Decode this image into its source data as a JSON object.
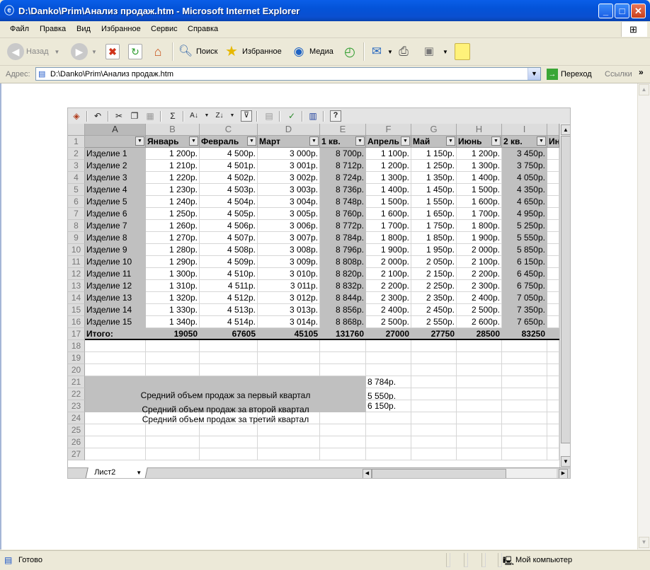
{
  "window": {
    "title": "D:\\Danko\\Prim\\Анализ продаж.htm - Microsoft Internet Explorer"
  },
  "menu": [
    "Файл",
    "Правка",
    "Вид",
    "Избранное",
    "Сервис",
    "Справка"
  ],
  "toolbar": {
    "back": "Назад",
    "search": "Поиск",
    "favorites": "Избранное",
    "media": "Медиа"
  },
  "address": {
    "label": "Адрес:",
    "url": "D:\\Danko\\Prim\\Анализ продаж.htm",
    "go": "Переход",
    "links": "Ссылки"
  },
  "status": {
    "text": "Готово",
    "zone": "Мой компьютер"
  },
  "spreadsheet": {
    "columns": [
      "A",
      "B",
      "C",
      "D",
      "E",
      "F",
      "G",
      "H",
      "I"
    ],
    "headers": [
      "",
      "Январь",
      "Февраль",
      "Март",
      "1 кв.",
      "Апрель",
      "Май",
      "Июнь",
      "2 кв.",
      "Ин"
    ],
    "rows": [
      [
        "Изделие 1",
        "1 200р.",
        "4 500р.",
        "3 000р.",
        "8 700р.",
        "1 100р.",
        "1 150р.",
        "1 200р.",
        "3 450р."
      ],
      [
        "Изделие 2",
        "1 210р.",
        "4 501р.",
        "3 001р.",
        "8 712р.",
        "1 200р.",
        "1 250р.",
        "1 300р.",
        "3 750р."
      ],
      [
        "Изделие 3",
        "1 220р.",
        "4 502р.",
        "3 002р.",
        "8 724р.",
        "1 300р.",
        "1 350р.",
        "1 400р.",
        "4 050р."
      ],
      [
        "Изделие 4",
        "1 230р.",
        "4 503р.",
        "3 003р.",
        "8 736р.",
        "1 400р.",
        "1 450р.",
        "1 500р.",
        "4 350р."
      ],
      [
        "Изделие 5",
        "1 240р.",
        "4 504р.",
        "3 004р.",
        "8 748р.",
        "1 500р.",
        "1 550р.",
        "1 600р.",
        "4 650р."
      ],
      [
        "Изделие 6",
        "1 250р.",
        "4 505р.",
        "3 005р.",
        "8 760р.",
        "1 600р.",
        "1 650р.",
        "1 700р.",
        "4 950р."
      ],
      [
        "Изделие 7",
        "1 260р.",
        "4 506р.",
        "3 006р.",
        "8 772р.",
        "1 700р.",
        "1 750р.",
        "1 800р.",
        "5 250р."
      ],
      [
        "Изделие 8",
        "1 270р.",
        "4 507р.",
        "3 007р.",
        "8 784р.",
        "1 800р.",
        "1 850р.",
        "1 900р.",
        "5 550р."
      ],
      [
        "Изделие 9",
        "1 280р.",
        "4 508р.",
        "3 008р.",
        "8 796р.",
        "1 900р.",
        "1 950р.",
        "2 000р.",
        "5 850р."
      ],
      [
        "Изделие 10",
        "1 290р.",
        "4 509р.",
        "3 009р.",
        "8 808р.",
        "2 000р.",
        "2 050р.",
        "2 100р.",
        "6 150р."
      ],
      [
        "Изделие 11",
        "1 300р.",
        "4 510р.",
        "3 010р.",
        "8 820р.",
        "2 100р.",
        "2 150р.",
        "2 200р.",
        "6 450р."
      ],
      [
        "Изделие 12",
        "1 310р.",
        "4 511р.",
        "3 011р.",
        "8 832р.",
        "2 200р.",
        "2 250р.",
        "2 300р.",
        "6 750р."
      ],
      [
        "Изделие 13",
        "1 320р.",
        "4 512р.",
        "3 012р.",
        "8 844р.",
        "2 300р.",
        "2 350р.",
        "2 400р.",
        "7 050р."
      ],
      [
        "Изделие 14",
        "1 330р.",
        "4 513р.",
        "3 013р.",
        "8 856р.",
        "2 400р.",
        "2 450р.",
        "2 500р.",
        "7 350р."
      ],
      [
        "Изделие 15",
        "1 340р.",
        "4 514р.",
        "3 014р.",
        "8 868р.",
        "2 500р.",
        "2 550р.",
        "2 600р.",
        "7 650р."
      ]
    ],
    "total": [
      "Итого:",
      "19050",
      "67605",
      "45105",
      "131760",
      "27000",
      "27750",
      "28500",
      "83250"
    ],
    "averages": [
      {
        "label": "Средний объем продаж за первый квартал",
        "value": "8 784р."
      },
      {
        "label": "Средний объем продаж за второй квартал",
        "value": "5 550р."
      },
      {
        "label": "Средний объем продаж за третий квартал",
        "value": "6 150р."
      }
    ],
    "sheet_tab": "Лист2"
  }
}
